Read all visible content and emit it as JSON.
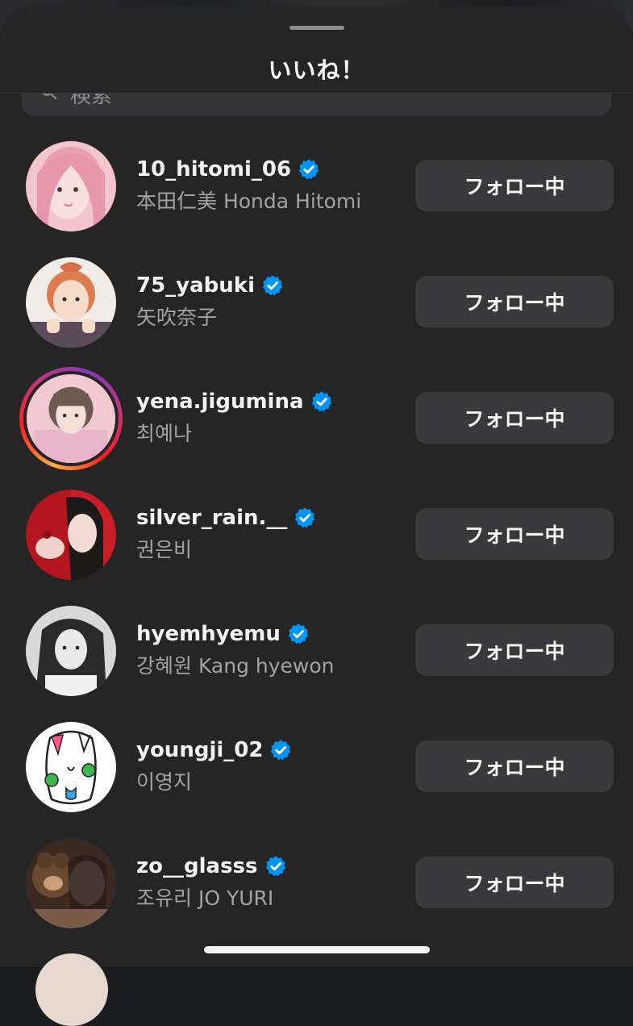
{
  "sheet": {
    "title": "いいね！"
  },
  "search": {
    "placeholder": "検索"
  },
  "follow_button_label": "フォロー中",
  "users": [
    {
      "username": "10_hitomi_06",
      "full_name": "本田仁美 Honda Hitomi",
      "verified": true,
      "has_story": false,
      "button": "フォロー中"
    },
    {
      "username": "75_yabuki",
      "full_name": "矢吹奈子",
      "verified": true,
      "has_story": false,
      "button": "フォロー中"
    },
    {
      "username": "yena.jigumina",
      "full_name": "최예나",
      "verified": true,
      "has_story": true,
      "button": "フォロー中"
    },
    {
      "username": "silver_rain.__",
      "full_name": "권은비",
      "verified": true,
      "has_story": false,
      "button": "フォロー中"
    },
    {
      "username": "hyemhyemu",
      "full_name": "강혜원 Kang hyewon",
      "verified": true,
      "has_story": false,
      "button": "フォロー中"
    },
    {
      "username": "youngji_02",
      "full_name": "이영지",
      "verified": true,
      "has_story": false,
      "button": "フォロー中"
    },
    {
      "username": "zo__glasss",
      "full_name": "조유리 JO YURI",
      "verified": true,
      "has_story": false,
      "button": "フォロー中"
    }
  ],
  "colors": {
    "sheet_background": "#252525",
    "button_background": "#3a3a3c",
    "verified_blue": "#0095f6",
    "secondary_text": "#a3a3a6"
  },
  "icons": {
    "search": "search-icon",
    "verified": "verified-badge-icon"
  }
}
